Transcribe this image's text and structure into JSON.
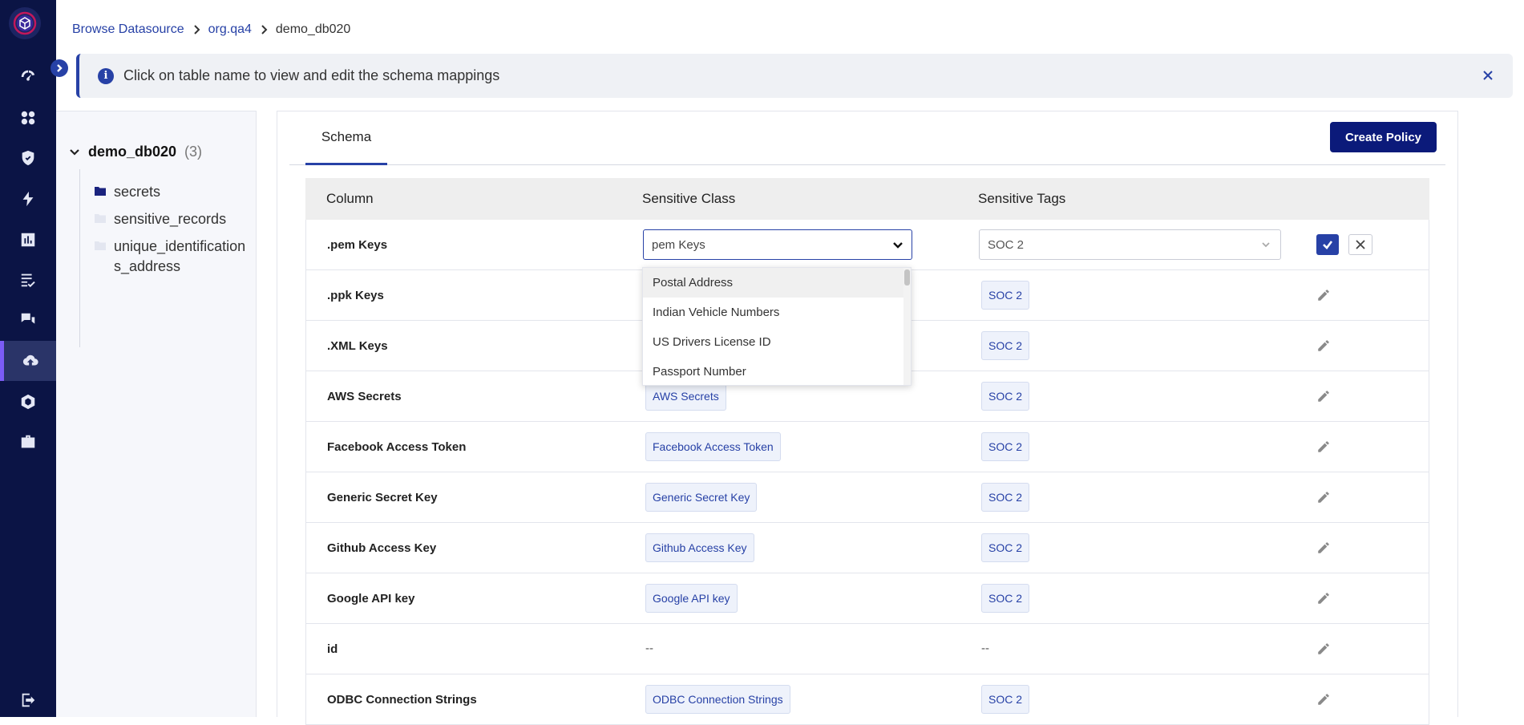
{
  "colors": {
    "accent": "#2741a6",
    "rail": "#0b1445",
    "primary_button": "#0b1a7a",
    "chip_bg": "#eef2fb"
  },
  "rail": {
    "items": [
      {
        "icon": "risk-gauge-icon",
        "active": false
      },
      {
        "icon": "cluster-icon",
        "active": false
      },
      {
        "icon": "shield-icon",
        "active": false
      },
      {
        "icon": "lightning-icon",
        "active": false
      },
      {
        "icon": "bar-chart-icon",
        "active": false
      },
      {
        "icon": "checklist-icon",
        "active": false
      },
      {
        "icon": "chat-icon",
        "active": false
      },
      {
        "icon": "cloud-upload-icon",
        "active": true
      },
      {
        "icon": "hexagon-icon",
        "active": false
      },
      {
        "icon": "briefcase-icon",
        "active": false
      }
    ],
    "logout_icon": "logout-icon"
  },
  "breadcrumb": {
    "items": [
      "Browse Datasource",
      "org.qa4"
    ],
    "current": "demo_db020"
  },
  "banner": {
    "text": "Click on table name to view and edit the schema mappings"
  },
  "tree": {
    "root": {
      "name": "demo_db020",
      "count": "(3)"
    },
    "children": [
      "secrets",
      "sensitive_records",
      "unique_identifications_address"
    ]
  },
  "tabs": [
    "Schema"
  ],
  "actions": {
    "create_policy": "Create Policy"
  },
  "table": {
    "headers": {
      "column": "Column",
      "sensitive_class": "Sensitive Class",
      "sensitive_tags": "Sensitive Tags"
    },
    "editing_row": {
      "column": ".pem Keys",
      "class_value": "pem Keys",
      "tag_value": "SOC 2"
    },
    "rows": [
      {
        "column": ".ppk Keys",
        "class": "",
        "tag": "SOC 2"
      },
      {
        "column": ".XML Keys",
        "class": "",
        "tag": "SOC 2"
      },
      {
        "column": "AWS Secrets",
        "class": "AWS Secrets",
        "tag": "SOC 2"
      },
      {
        "column": "Facebook Access Token",
        "class": "Facebook Access Token",
        "tag": "SOC 2"
      },
      {
        "column": "Generic Secret Key",
        "class": "Generic Secret Key",
        "tag": "SOC 2"
      },
      {
        "column": "Github Access Key",
        "class": "Github Access Key",
        "tag": "SOC 2"
      },
      {
        "column": "Google API key",
        "class": "Google API key",
        "tag": "SOC 2"
      },
      {
        "column": "id",
        "class": "--",
        "tag": "--"
      },
      {
        "column": "ODBC Connection Strings",
        "class": "ODBC Connection Strings",
        "tag": "SOC 2"
      }
    ]
  },
  "dropdown": {
    "options": [
      "Postal Address",
      "Indian Vehicle Numbers",
      "US Drivers License ID",
      "Passport Number"
    ],
    "highlighted": 0
  }
}
